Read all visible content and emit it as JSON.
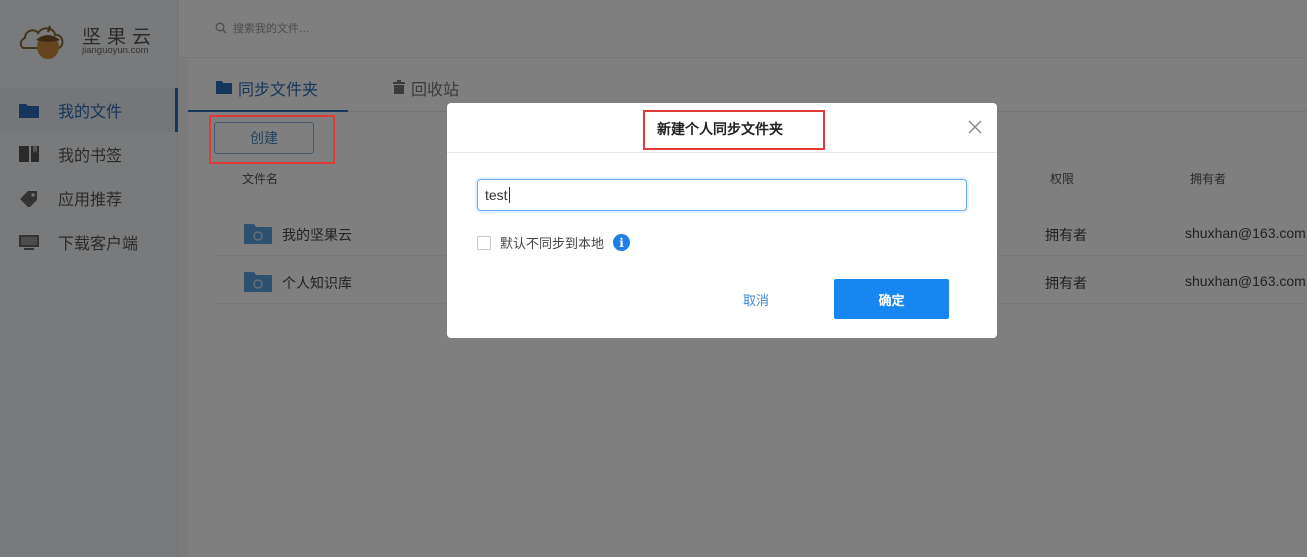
{
  "app": {
    "brand_cn": "坚果云",
    "brand_domain": "jianguoyun.com"
  },
  "search": {
    "placeholder": "搜索我的文件..."
  },
  "sidebar": {
    "items": [
      {
        "label": "我的文件",
        "icon": "folder-icon",
        "active": true
      },
      {
        "label": "我的书签",
        "icon": "bookmark-icon",
        "active": false
      },
      {
        "label": "应用推荐",
        "icon": "tag-icon",
        "active": false
      },
      {
        "label": "下载客户端",
        "icon": "monitor-icon",
        "active": false
      }
    ]
  },
  "tabs": [
    {
      "label": "同步文件夹",
      "icon": "folder-icon",
      "active": true
    },
    {
      "label": "回收站",
      "icon": "trash-icon",
      "active": false
    }
  ],
  "toolbar": {
    "create_label": "创建"
  },
  "table": {
    "headers": {
      "name": "文件名",
      "permission": "权限",
      "owner": "拥有者"
    },
    "rows": [
      {
        "name": "我的坚果云",
        "permission": "拥有者",
        "owner": "shuxhan@163.com"
      },
      {
        "name": "个人知识库",
        "permission": "拥有者",
        "owner": "shuxhan@163.com"
      }
    ]
  },
  "modal": {
    "title": "新建个人同步文件夹",
    "input_value": "test",
    "checkbox_label": "默认不同步到本地",
    "checkbox_checked": false,
    "cancel_label": "取消",
    "confirm_label": "确定"
  },
  "colors": {
    "accent": "#2b6bb5",
    "primary_button": "#1886f0",
    "highlight": "#e03a3a"
  }
}
